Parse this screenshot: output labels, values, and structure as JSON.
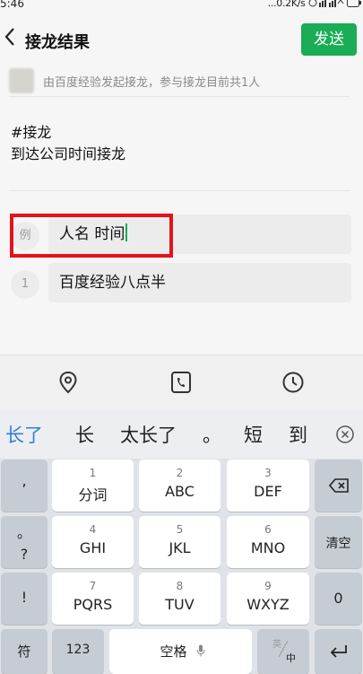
{
  "status_bar": {
    "time": "5:46",
    "right": "...0.2K/s"
  },
  "header": {
    "title": "接龙结果",
    "send_label": "发送"
  },
  "info": {
    "text": "由百度经验发起接龙，参与接龙目前共1人"
  },
  "topic": {
    "line1": "#接龙",
    "line2": "到达公司时间接龙"
  },
  "entries": [
    {
      "badge": "例",
      "text": "人名 时间"
    },
    {
      "badge": "1",
      "text": "百度经验八点半"
    }
  ],
  "toolbar": {
    "icons": [
      "location-icon",
      "phone-card-icon",
      "clock-icon"
    ]
  },
  "candidates": [
    "长了",
    "长",
    "太长了",
    "。",
    "短",
    "到"
  ],
  "keyboard": {
    "left_col": [
      ",",
      "。",
      "?",
      "!"
    ],
    "rows": [
      [
        {
          "num": "1",
          "lbl": "分词"
        },
        {
          "num": "2",
          "lbl": "ABC"
        },
        {
          "num": "3",
          "lbl": "DEF"
        }
      ],
      [
        {
          "num": "4",
          "lbl": "GHI"
        },
        {
          "num": "5",
          "lbl": "JKL"
        },
        {
          "num": "6",
          "lbl": "MNO"
        }
      ],
      [
        {
          "num": "7",
          "lbl": "PQRS"
        },
        {
          "num": "8",
          "lbl": "TUV"
        },
        {
          "num": "9",
          "lbl": "WXYZ"
        }
      ]
    ],
    "right_col": {
      "clear": "清空",
      "zero": "0"
    },
    "bottom": {
      "symbols": "符",
      "numbers": "123",
      "space": "空格",
      "lang_en": "英",
      "lang_zh": "中"
    }
  },
  "colors": {
    "accent": "#1aad55",
    "highlight": "#e2141a",
    "candidate_first": "#2f7fd6"
  }
}
